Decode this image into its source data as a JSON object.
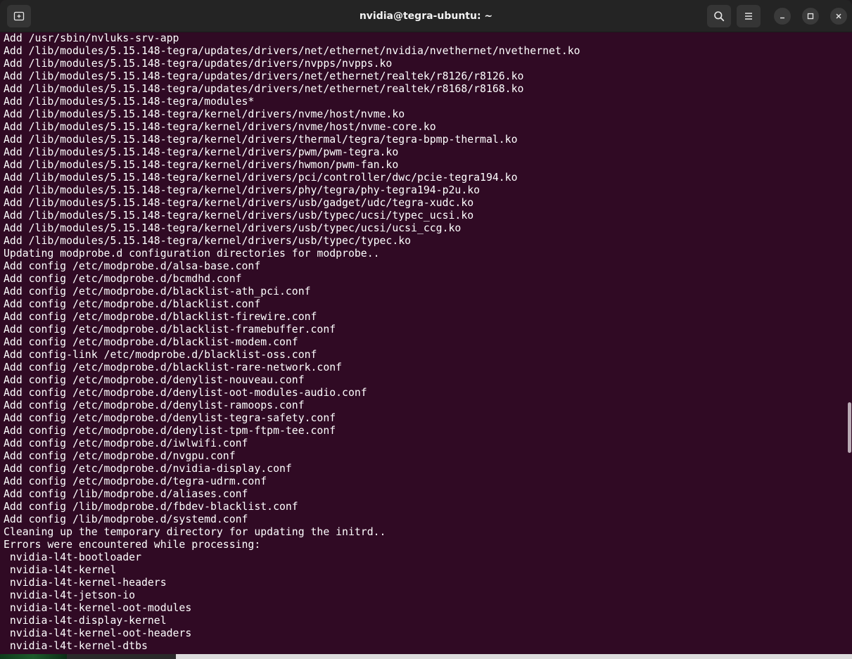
{
  "window": {
    "title": "nvidia@tegra-ubuntu: ~",
    "new_tab_icon": "new-tab-icon",
    "search_icon": "search-icon",
    "menu_icon": "hamburger-menu-icon",
    "minimize_icon": "minimize-icon",
    "maximize_icon": "maximize-icon",
    "close_icon": "close-icon"
  },
  "colors": {
    "terminal_bg": "#300a24",
    "titlebar_bg": "#242424",
    "text": "#ffffff"
  },
  "terminal": {
    "lines": [
      "Add /usr/sbin/nvluks-srv-app",
      "Add /lib/modules/5.15.148-tegra/updates/drivers/net/ethernet/nvidia/nvethernet/nvethernet.ko",
      "Add /lib/modules/5.15.148-tegra/updates/drivers/nvpps/nvpps.ko",
      "Add /lib/modules/5.15.148-tegra/updates/drivers/net/ethernet/realtek/r8126/r8126.ko",
      "Add /lib/modules/5.15.148-tegra/updates/drivers/net/ethernet/realtek/r8168/r8168.ko",
      "Add /lib/modules/5.15.148-tegra/modules*",
      "Add /lib/modules/5.15.148-tegra/kernel/drivers/nvme/host/nvme.ko",
      "Add /lib/modules/5.15.148-tegra/kernel/drivers/nvme/host/nvme-core.ko",
      "Add /lib/modules/5.15.148-tegra/kernel/drivers/thermal/tegra/tegra-bpmp-thermal.ko",
      "Add /lib/modules/5.15.148-tegra/kernel/drivers/pwm/pwm-tegra.ko",
      "Add /lib/modules/5.15.148-tegra/kernel/drivers/hwmon/pwm-fan.ko",
      "Add /lib/modules/5.15.148-tegra/kernel/drivers/pci/controller/dwc/pcie-tegra194.ko",
      "Add /lib/modules/5.15.148-tegra/kernel/drivers/phy/tegra/phy-tegra194-p2u.ko",
      "Add /lib/modules/5.15.148-tegra/kernel/drivers/usb/gadget/udc/tegra-xudc.ko",
      "Add /lib/modules/5.15.148-tegra/kernel/drivers/usb/typec/ucsi/typec_ucsi.ko",
      "Add /lib/modules/5.15.148-tegra/kernel/drivers/usb/typec/ucsi/ucsi_ccg.ko",
      "Add /lib/modules/5.15.148-tegra/kernel/drivers/usb/typec/typec.ko",
      "Updating modprobe.d configuration directories for modprobe..",
      "Add config /etc/modprobe.d/alsa-base.conf",
      "Add config /etc/modprobe.d/bcmdhd.conf",
      "Add config /etc/modprobe.d/blacklist-ath_pci.conf",
      "Add config /etc/modprobe.d/blacklist.conf",
      "Add config /etc/modprobe.d/blacklist-firewire.conf",
      "Add config /etc/modprobe.d/blacklist-framebuffer.conf",
      "Add config /etc/modprobe.d/blacklist-modem.conf",
      "Add config-link /etc/modprobe.d/blacklist-oss.conf",
      "Add config /etc/modprobe.d/blacklist-rare-network.conf",
      "Add config /etc/modprobe.d/denylist-nouveau.conf",
      "Add config /etc/modprobe.d/denylist-oot-modules-audio.conf",
      "Add config /etc/modprobe.d/denylist-ramoops.conf",
      "Add config /etc/modprobe.d/denylist-tegra-safety.conf",
      "Add config /etc/modprobe.d/denylist-tpm-ftpm-tee.conf",
      "Add config /etc/modprobe.d/iwlwifi.conf",
      "Add config /etc/modprobe.d/nvgpu.conf",
      "Add config /etc/modprobe.d/nvidia-display.conf",
      "Add config /etc/modprobe.d/tegra-udrm.conf",
      "Add config /lib/modprobe.d/aliases.conf",
      "Add config /lib/modprobe.d/fbdev-blacklist.conf",
      "Add config /lib/modprobe.d/systemd.conf",
      "Cleaning up the temporary directory for updating the initrd..",
      "Errors were encountered while processing:",
      " nvidia-l4t-bootloader",
      " nvidia-l4t-kernel",
      " nvidia-l4t-kernel-headers",
      " nvidia-l4t-jetson-io",
      " nvidia-l4t-kernel-oot-modules",
      " nvidia-l4t-display-kernel",
      " nvidia-l4t-kernel-oot-headers",
      " nvidia-l4t-kernel-dtbs"
    ]
  }
}
